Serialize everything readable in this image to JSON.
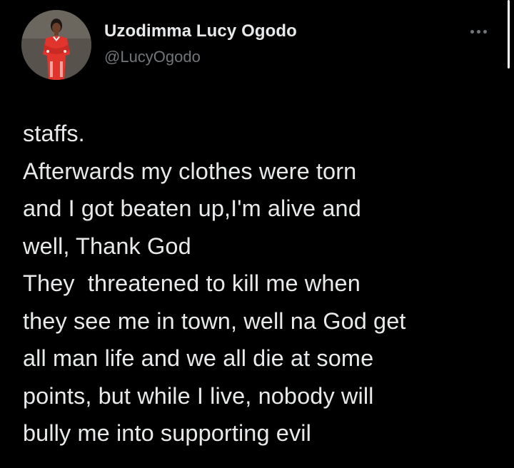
{
  "tweet": {
    "author": {
      "display_name": "Uzodimma Lucy Ogodo",
      "handle": "@LucyOgodo",
      "avatar_icon": "profile-photo"
    },
    "menu_icon": "more-horizontal-icon",
    "text_lines": [
      "staffs.",
      "Afterwards my clothes were torn",
      "and I got beaten up,I'm alive and",
      "well, Thank God",
      "They  threatened to kill me when",
      "they see me in town, well na God get",
      "all man life and we all die at some",
      "points, but while I live, nobody will",
      "bully me into supporting evil"
    ]
  },
  "colors": {
    "background": "#000000",
    "primary_text": "#e7e9ea",
    "secondary_text": "#71767b",
    "avatar_outfit": "#e0342c"
  }
}
